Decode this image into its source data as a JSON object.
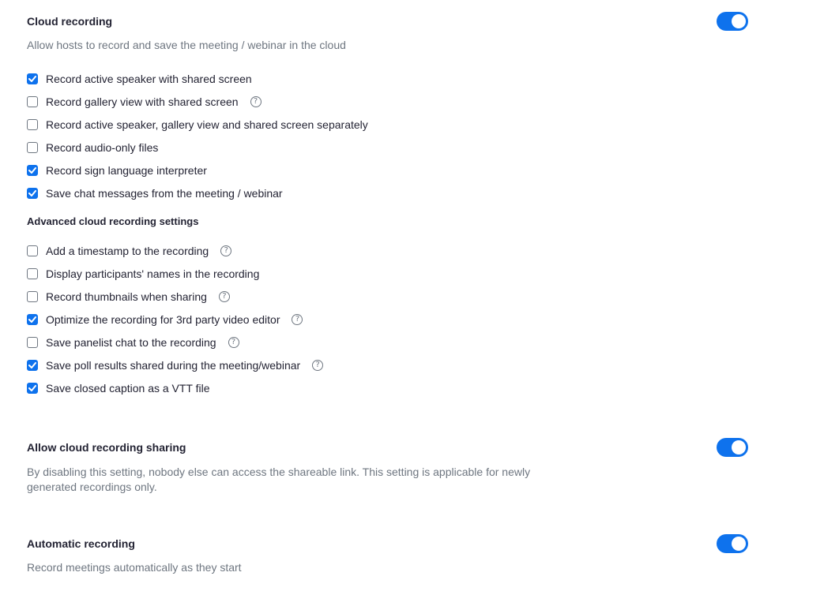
{
  "cloud_recording": {
    "title": "Cloud recording",
    "description": "Allow hosts to record and save the meeting / webinar in the cloud",
    "enabled": true,
    "options": [
      {
        "label": "Record active speaker with shared screen",
        "checked": true,
        "help": false
      },
      {
        "label": "Record gallery view with shared screen",
        "checked": false,
        "help": true
      },
      {
        "label": "Record active speaker, gallery view and shared screen separately",
        "checked": false,
        "help": false
      },
      {
        "label": "Record audio-only files",
        "checked": false,
        "help": false
      },
      {
        "label": "Record sign language interpreter",
        "checked": true,
        "help": false
      },
      {
        "label": "Save chat messages from the meeting / webinar",
        "checked": true,
        "help": false
      }
    ],
    "advanced_heading": "Advanced cloud recording settings",
    "advanced_options": [
      {
        "label": "Add a timestamp to the recording",
        "checked": false,
        "help": true
      },
      {
        "label": "Display participants' names in the recording",
        "checked": false,
        "help": false
      },
      {
        "label": "Record thumbnails when sharing",
        "checked": false,
        "help": true
      },
      {
        "label": "Optimize the recording for 3rd party video editor",
        "checked": true,
        "help": true
      },
      {
        "label": "Save panelist chat to the recording",
        "checked": false,
        "help": true
      },
      {
        "label": "Save poll results shared during the meeting/webinar",
        "checked": true,
        "help": true
      },
      {
        "label": "Save closed caption as a VTT file",
        "checked": true,
        "help": false
      }
    ]
  },
  "cloud_sharing": {
    "title": "Allow cloud recording sharing",
    "description": "By disabling this setting, nobody else can access the shareable link. This setting is applicable for newly generated recordings only.",
    "enabled": true
  },
  "automatic_recording": {
    "title": "Automatic recording",
    "description": "Record meetings automatically as they start",
    "enabled": true
  },
  "help_icon_glyph": "?",
  "colors": {
    "accent": "#0e72ed",
    "text": "#232333",
    "muted": "#6e7680"
  }
}
